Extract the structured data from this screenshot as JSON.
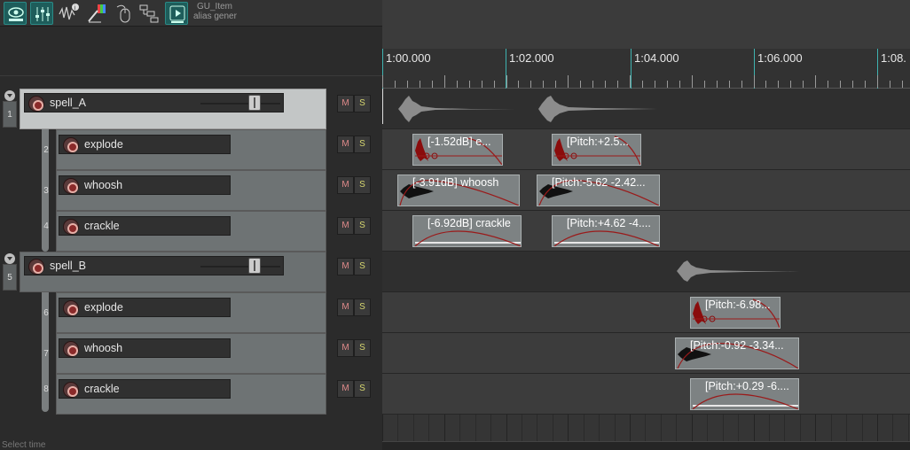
{
  "toolbar": {
    "item_name": "GU_Item",
    "item_alias": "alias gener",
    "icons": [
      "track-visibility-icon",
      "mixer-icon",
      "envelope-info-icon",
      "color-edit-icon",
      "mouse-modifier-icon",
      "routing-matrix-icon",
      "transport-play-icon"
    ]
  },
  "ruler": {
    "labels": [
      "1:00.000",
      "1:02.000",
      "1:04.000",
      "1:06.000",
      "1:08."
    ]
  },
  "tracks": [
    {
      "num": "1",
      "name": "spell_A",
      "type": "folder",
      "mute": "M",
      "solo": "S"
    },
    {
      "num": "2",
      "name": "explode",
      "type": "child",
      "mute": "M",
      "solo": "S"
    },
    {
      "num": "3",
      "name": "whoosh",
      "type": "child",
      "mute": "M",
      "solo": "S"
    },
    {
      "num": "4",
      "name": "crackle",
      "type": "child",
      "mute": "M",
      "solo": "S"
    },
    {
      "num": "5",
      "name": "spell_B",
      "type": "folder",
      "mute": "M",
      "solo": "S"
    },
    {
      "num": "6",
      "name": "explode",
      "type": "child",
      "mute": "M",
      "solo": "S"
    },
    {
      "num": "7",
      "name": "whoosh",
      "type": "child",
      "mute": "M",
      "solo": "S"
    },
    {
      "num": "8",
      "name": "crackle",
      "type": "child",
      "mute": "M",
      "solo": "S"
    }
  ],
  "items": [
    {
      "lane": 1,
      "label": "[-1.52dB] e...",
      "kind": "explode"
    },
    {
      "lane": 1,
      "label": "[Pitch:+2.5...",
      "kind": "explode"
    },
    {
      "lane": 2,
      "label": "[-3.91dB] whoosh",
      "kind": "whoosh"
    },
    {
      "lane": 2,
      "label": "[Pitch:-5.62 -2.42...",
      "kind": "whoosh"
    },
    {
      "lane": 3,
      "label": "[-6.92dB] crackle",
      "kind": "crackle"
    },
    {
      "lane": 3,
      "label": "[Pitch:+4.62 -4....",
      "kind": "crackle"
    },
    {
      "lane": 5,
      "label": "[Pitch:-6.98...",
      "kind": "explode"
    },
    {
      "lane": 6,
      "label": "[Pitch:-0.92 -3.34...",
      "kind": "whoosh"
    },
    {
      "lane": 7,
      "label": "[Pitch:+0.29 -6....",
      "kind": "crackle"
    }
  ],
  "status": {
    "text": "Select time"
  }
}
